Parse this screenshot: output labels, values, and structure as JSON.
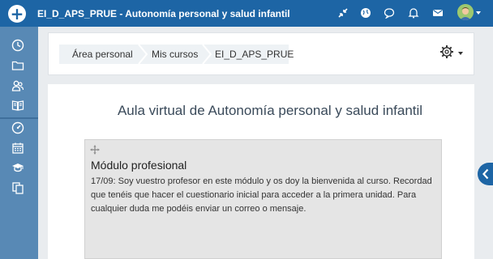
{
  "header": {
    "add_icon": "plus-icon",
    "course_title": "EI_D_APS_PRUE - Autonomía personal y salud infantil",
    "icons": [
      "compress-icon",
      "globe-icon",
      "chat-icon",
      "bell-icon",
      "mail-icon"
    ],
    "avatar": "user-avatar"
  },
  "sidebar": {
    "items": [
      {
        "icon": "clock-icon"
      },
      {
        "icon": "folder-icon"
      },
      {
        "icon": "users-icon"
      },
      {
        "icon": "book-icon"
      },
      {
        "icon": "dashboard-icon"
      },
      {
        "icon": "calendar-icon"
      },
      {
        "icon": "graduation-cap-icon"
      },
      {
        "icon": "copy-icon"
      }
    ]
  },
  "breadcrumb": [
    "Área personal",
    "Mis cursos",
    "EI_D_APS_PRUE"
  ],
  "settings_icon": "gear-icon",
  "main": {
    "heading": "Aula virtual de Autonomía personal y salud infantil",
    "section": {
      "title": "Módulo profesional",
      "summary": "17/09: Soy vuestro profesor en este módulo y os doy la bienvenida al curso. Recordad que tenéis que hacer el cuestionario inicial para acceder a la primera unidad. Para cualquier duda me podéis enviar un correo o mensaje."
    }
  },
  "colors": {
    "navbar": "#1d65a5",
    "sidebar": "#5889b5",
    "section_bg": "#e5e5e5"
  }
}
